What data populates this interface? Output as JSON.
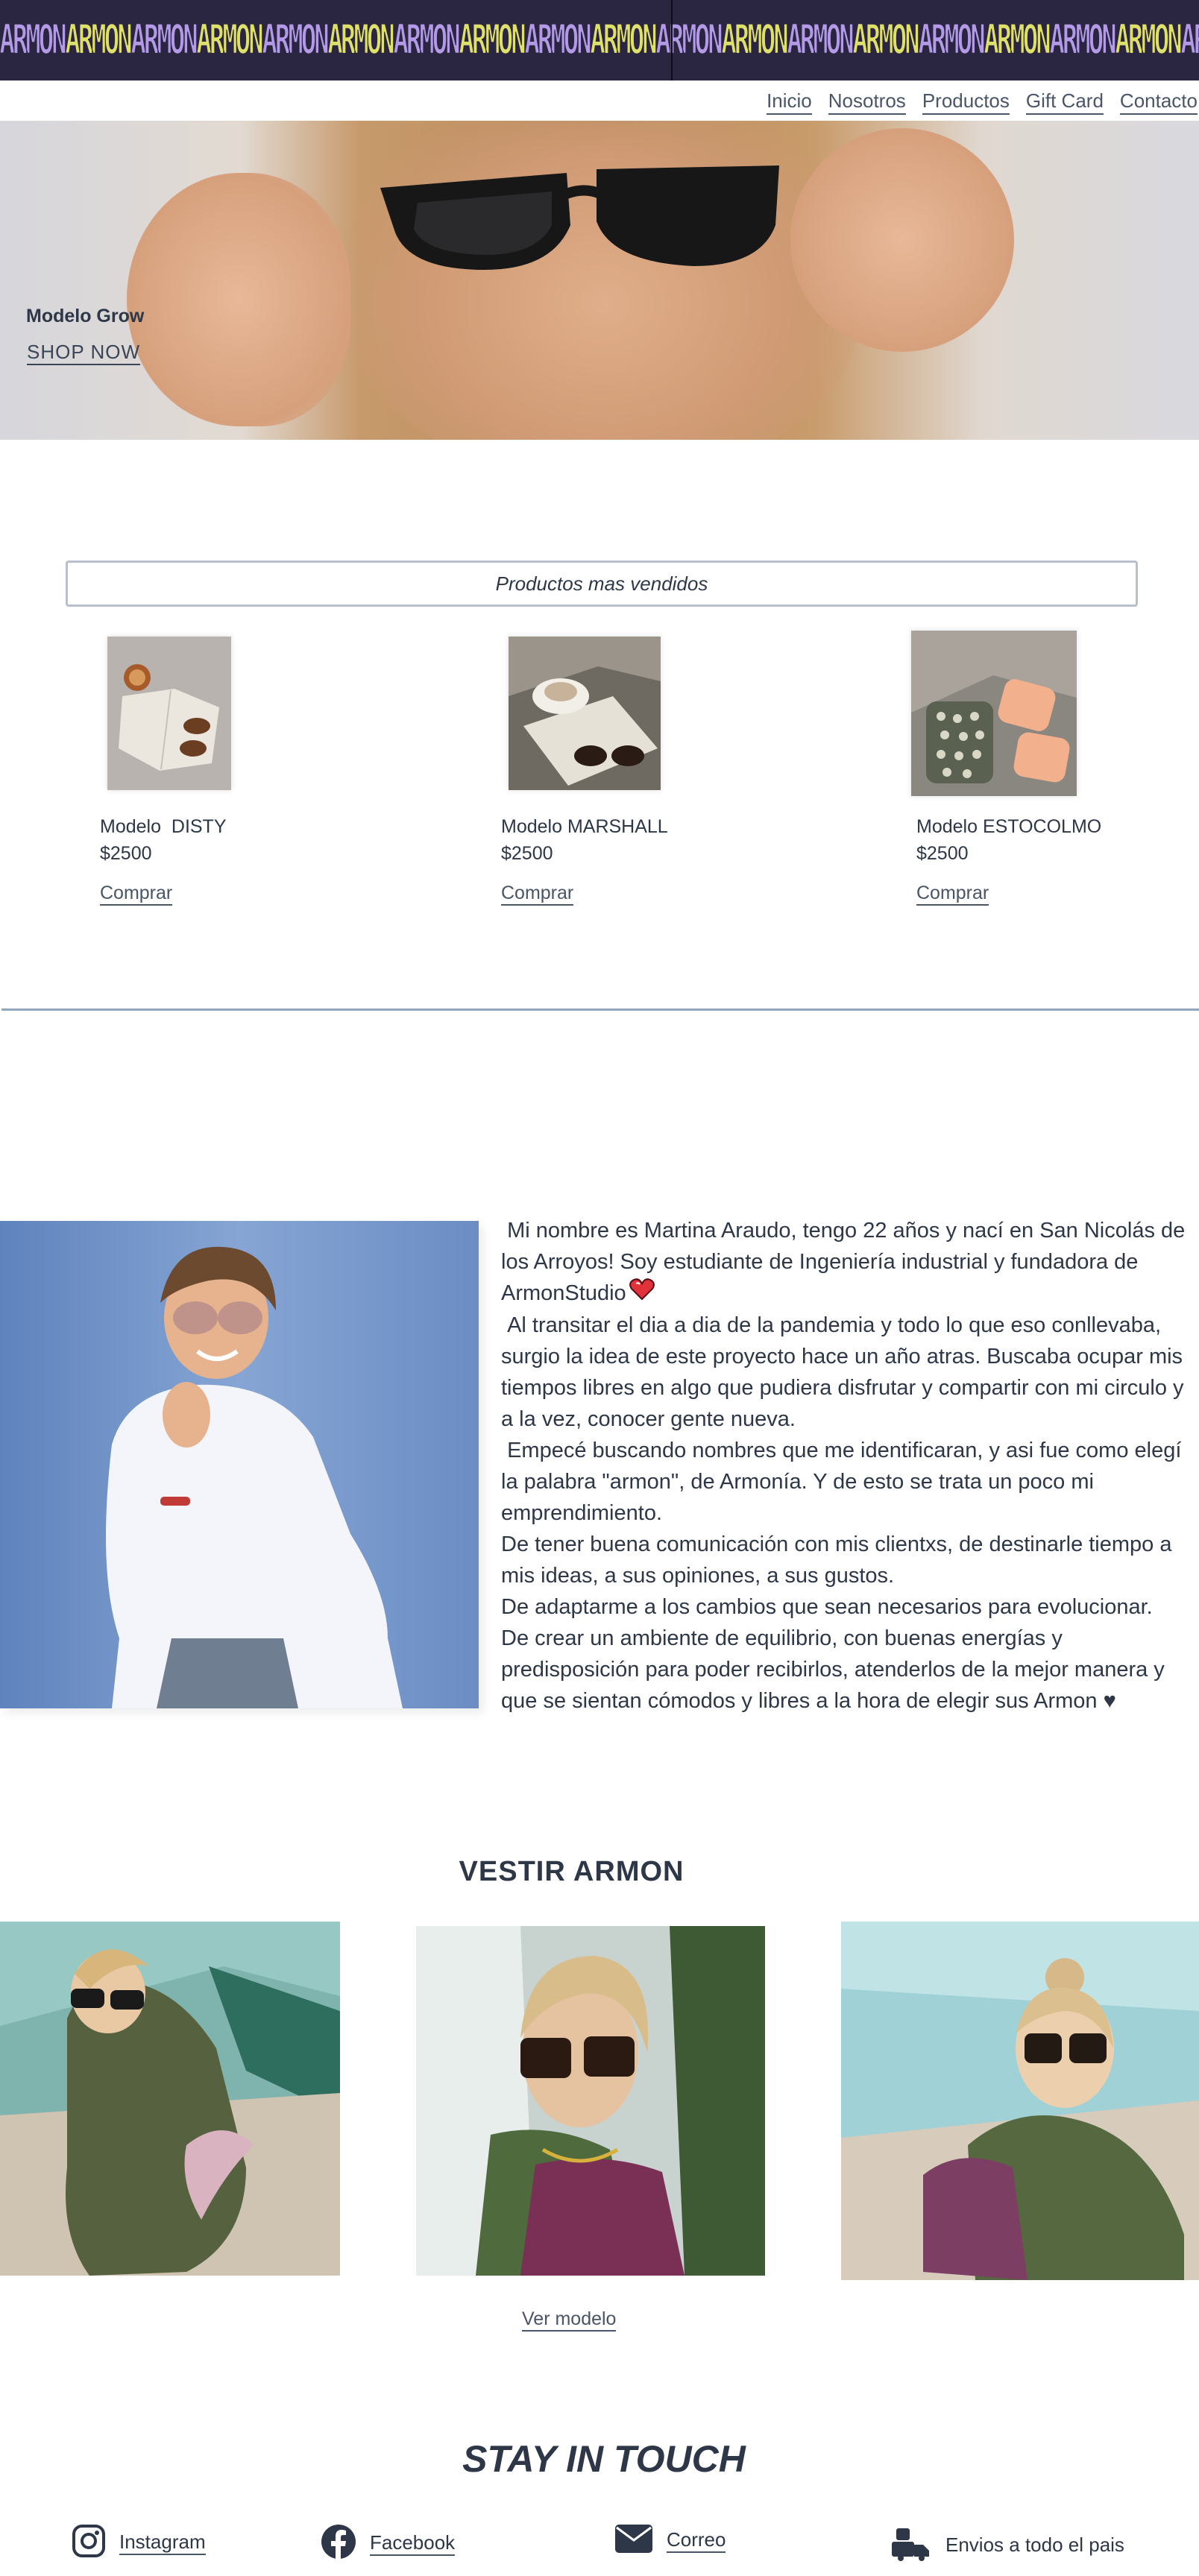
{
  "banner": {
    "brand_text": "ARMON",
    "colors": {
      "background": "#2a2540",
      "violet": "#b29ae6",
      "yellow": "#dfe06a"
    }
  },
  "nav": {
    "items": [
      "Inicio",
      "Nosotros",
      "Productos",
      "Gift Card",
      "Contacto"
    ]
  },
  "hero": {
    "title": "Modelo Grow",
    "cta": "SHOP NOW"
  },
  "bestsellers": {
    "heading": "Productos mas vendidos",
    "products": [
      {
        "name": "Modelo  DISTY",
        "price": "$2500",
        "buy": "Comprar"
      },
      {
        "name": "Modelo MARSHALL",
        "price": "$2500",
        "buy": "Comprar"
      },
      {
        "name": "Modelo ESTOCOLMO",
        "price": "$2500",
        "buy": "Comprar"
      }
    ]
  },
  "about": {
    "paragraphs": [
      " Mi nombre es Martina Araudo, tengo 22 años y nací en San Nicolás de los Arroyos! Soy estudiante de Ingeniería industrial y fundadora de ArmonStudio",
      " Al transitar el dia a dia de la pandemia y todo lo que eso conllevaba, surgio la idea de este proyecto hace un año atras. Buscaba ocupar mis tiempos libres en algo que pudiera disfrutar y compartir con mi circulo y a la vez, conocer gente nueva.",
      " Empecé buscando nombres que me identificaran, y asi fue como elegí la palabra \"armon\", de Armonía. Y de esto se trata un poco mi emprendimiento.",
      "De tener buena comunicación con mis clientxs, de destinarle tiempo a mis ideas, a sus opiniones, a sus gustos.",
      "De adaptarme a los cambios que sean necesarios para evolucionar.",
      "De crear un ambiente de equilibrio, con buenas energías y predisposición para poder recibirlos, atenderlos de la mejor manera y que se sientan cómodos y libres a la hora de elegir sus Armon ♥"
    ]
  },
  "vestir": {
    "title": "VESTIR ARMON",
    "cta": "Ver modelo"
  },
  "footer": {
    "title": "STAY IN TOUCH",
    "items": [
      {
        "label": "Instagram",
        "icon": "instagram-icon"
      },
      {
        "label": "Facebook",
        "icon": "facebook-icon"
      },
      {
        "label": "Correo",
        "icon": "mail-icon"
      },
      {
        "label": "Envios a todo el pais",
        "icon": "delivery-icon"
      }
    ]
  }
}
